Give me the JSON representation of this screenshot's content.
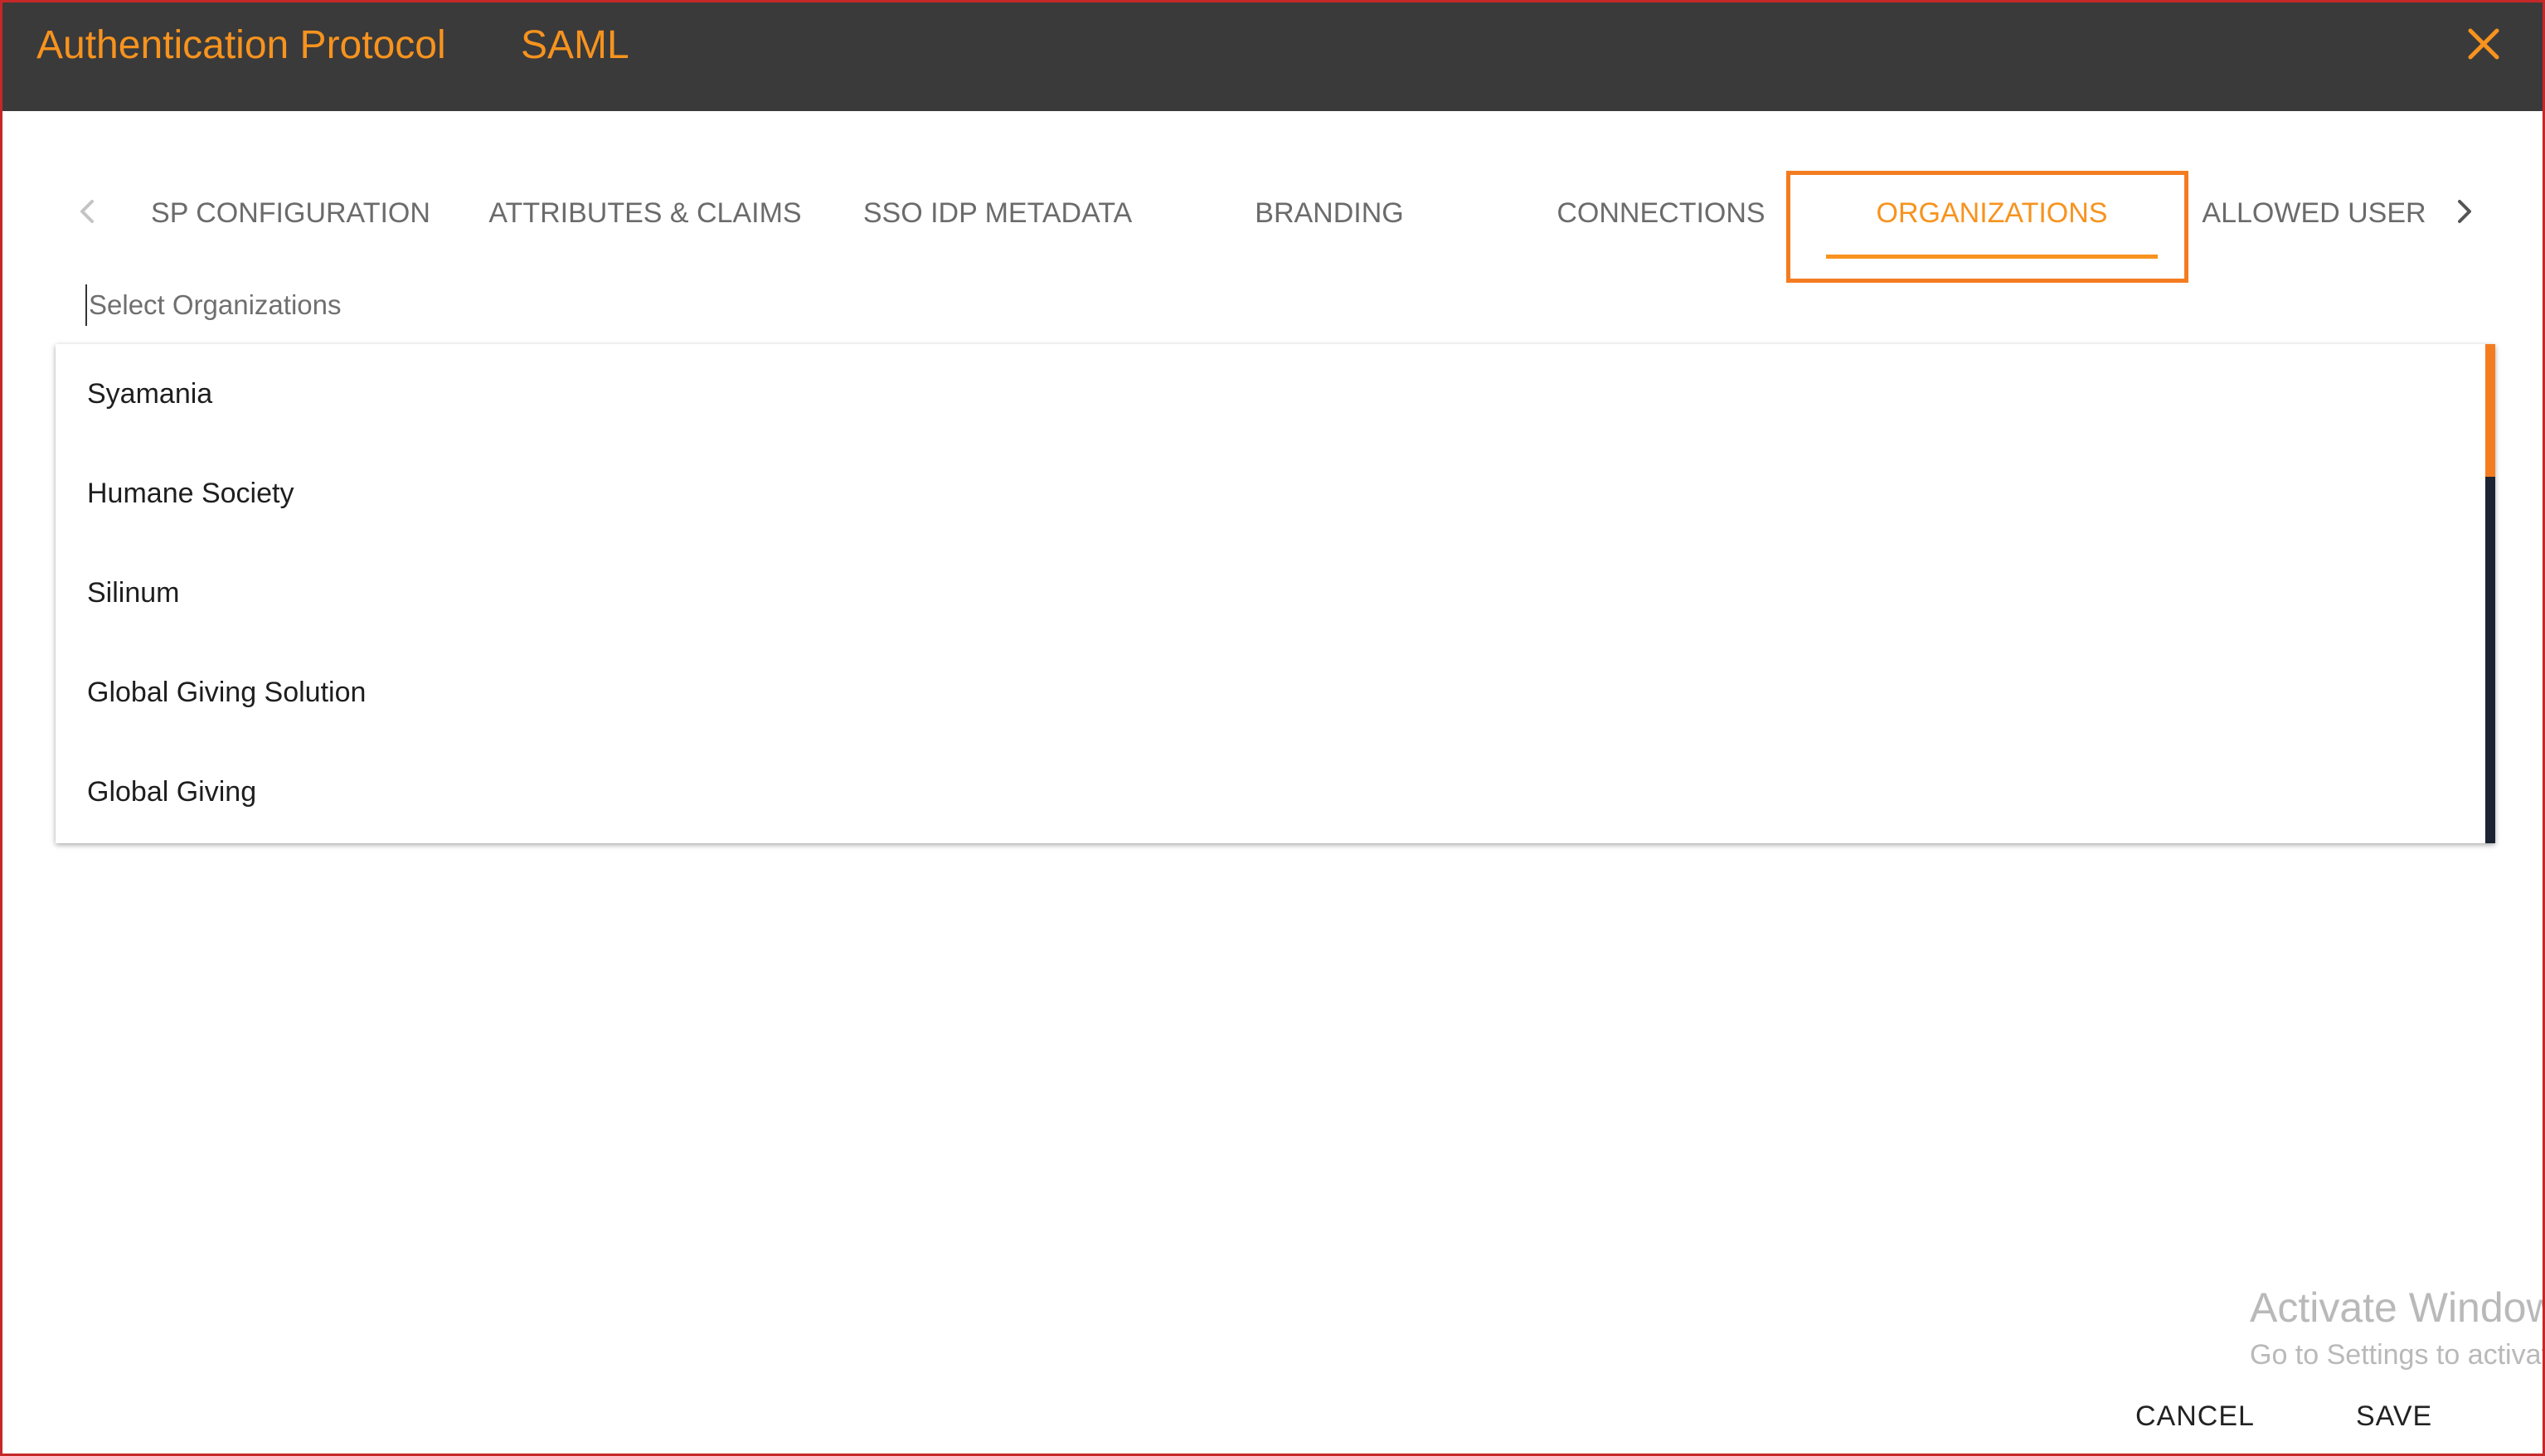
{
  "header": {
    "title": "Authentication Protocol",
    "protocol": "SAML",
    "close_icon": "close-icon"
  },
  "tabs": {
    "prev_icon": "chevron-left-icon",
    "next_icon": "chevron-right-icon",
    "items": [
      {
        "label": "SP CONFIGURATION"
      },
      {
        "label": "ATTRIBUTES & CLAIMS"
      },
      {
        "label": "SSO IDP METADATA"
      },
      {
        "label": "BRANDING"
      },
      {
        "label": "CONNECTIONS"
      },
      {
        "label": "ORGANIZATIONS"
      },
      {
        "label": "ALLOWED USER"
      }
    ],
    "active": "ORGANIZATIONS"
  },
  "select": {
    "placeholder": "Select Organizations",
    "value": ""
  },
  "dropdown": {
    "options": [
      {
        "label": "Syamania"
      },
      {
        "label": "Humane Society"
      },
      {
        "label": "Silinum"
      },
      {
        "label": "Global Giving Solution"
      },
      {
        "label": "Global Giving"
      }
    ]
  },
  "watermark": {
    "title": "Activate Windows",
    "subtitle": "Go to Settings to activate Windows."
  },
  "footer": {
    "cancel_label": "CANCEL",
    "save_label": "SAVE"
  },
  "colors": {
    "accent": "#f7931e",
    "header_bg": "#3a3a3a",
    "highlight_border": "#f47c20",
    "scrollbar_track": "#1c2333"
  }
}
